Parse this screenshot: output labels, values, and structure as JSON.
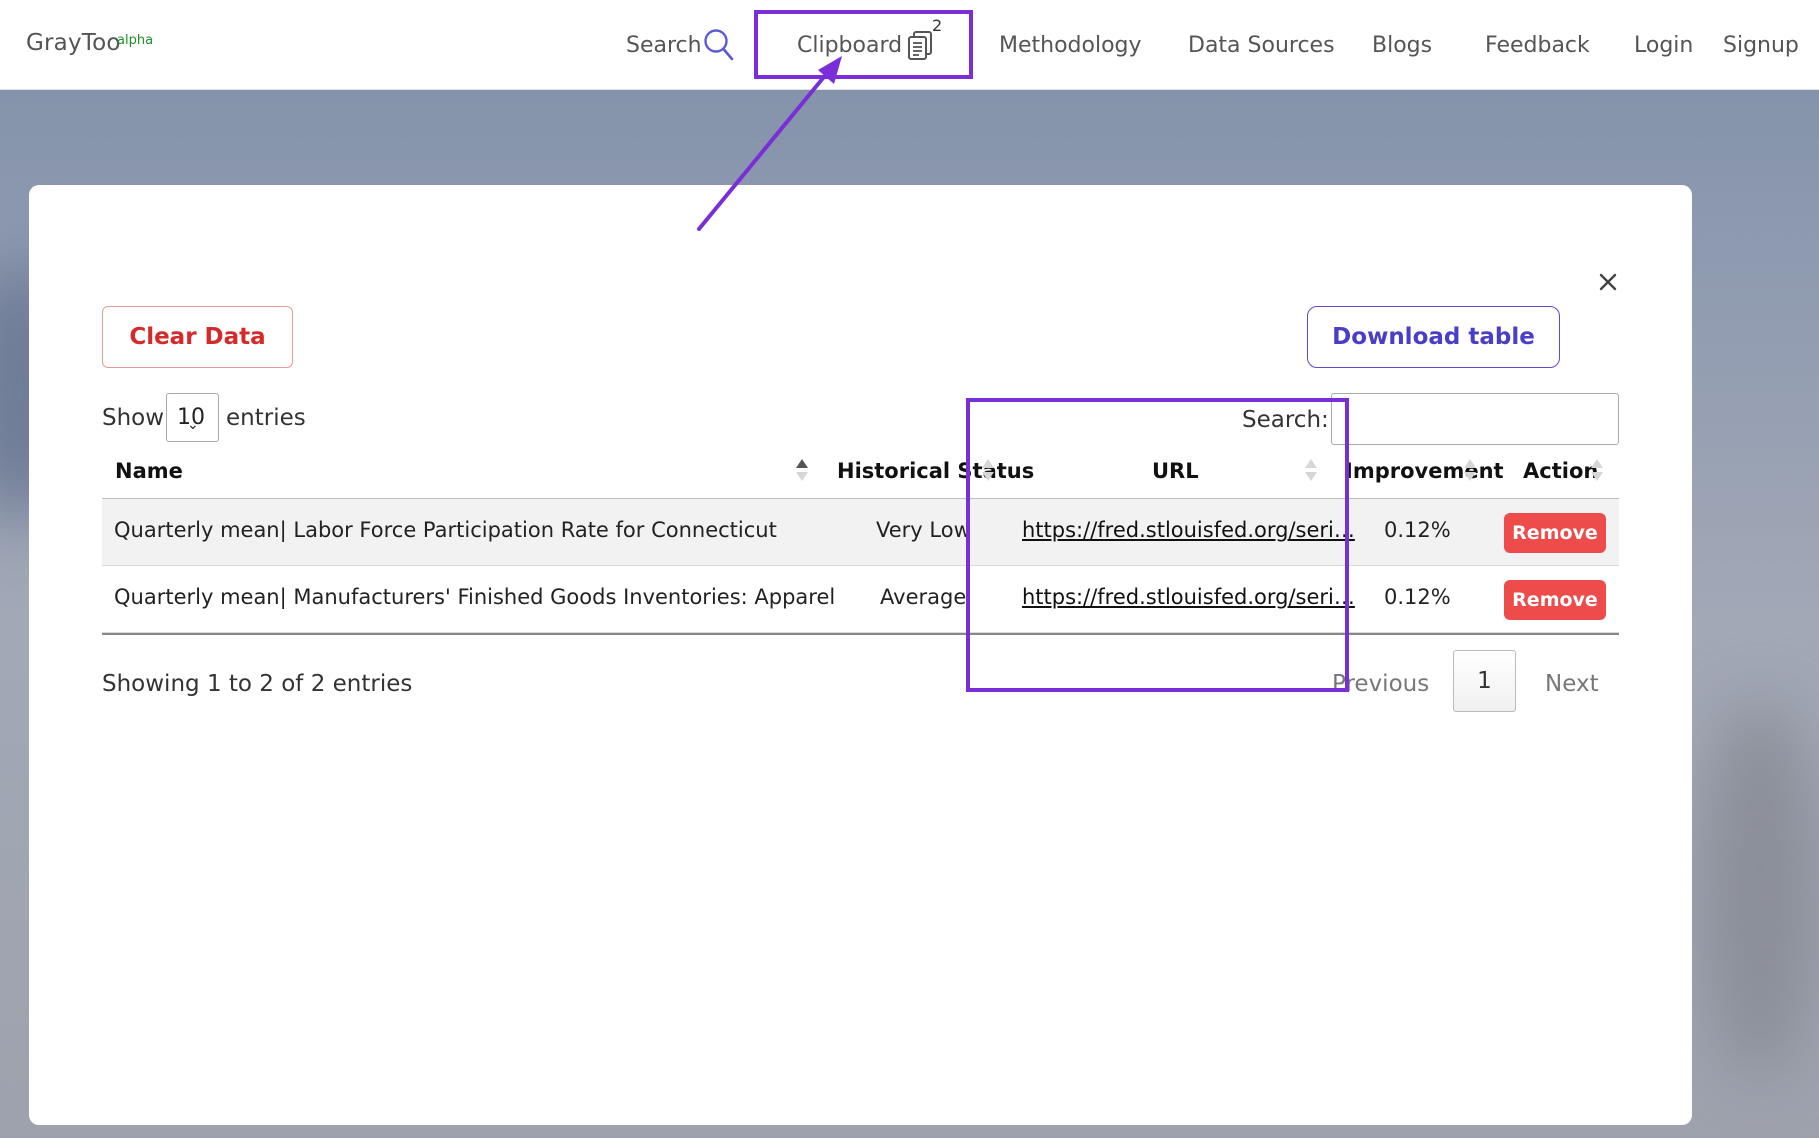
{
  "colors": {
    "accent_purple": "#7a2fd6",
    "danger_red": "#ee4b4b",
    "brand_green": "#1f8f2a",
    "download_blue": "#4a3dc8"
  },
  "navbar": {
    "brand": "GrayToo",
    "brand_sup": "alpha",
    "search_label": "Search",
    "search_icon": "magnifier-icon",
    "clipboard_label": "Clipboard",
    "clipboard_icon": "clipboard-copy-icon",
    "clipboard_count": "2",
    "items": [
      {
        "label": "Methodology"
      },
      {
        "label": "Data Sources"
      },
      {
        "label": "Blogs"
      },
      {
        "label": "Feedback"
      },
      {
        "label": "Login"
      },
      {
        "label": "Signup"
      }
    ]
  },
  "modal": {
    "close_icon": "close-x-icon",
    "clear_button": "Clear Data",
    "download_button": "Download table",
    "length": {
      "show_label": "Show",
      "value": "10",
      "entries_label": "entries"
    },
    "search": {
      "label": "Search:",
      "value": "",
      "placeholder": ""
    },
    "table": {
      "columns": [
        "Name",
        "Historical Status",
        "URL",
        "Improvement",
        "Action"
      ],
      "rows": [
        {
          "name": "Quarterly mean| Labor Force Participation Rate for Connecticut",
          "status": "Very Low",
          "url": "https://fred.stlouisfed.org/seri…",
          "improvement": "0.12%",
          "action": "Remove"
        },
        {
          "name": "Quarterly mean| Manufacturers' Finished Goods Inventories: Apparel",
          "status": "Average",
          "url": "https://fred.stlouisfed.org/seri…",
          "improvement": "0.12%",
          "action": "Remove"
        }
      ]
    },
    "info": "Showing 1 to 2 of 2 entries",
    "pagination": {
      "previous": "Previous",
      "current": "1",
      "next": "Next"
    }
  }
}
